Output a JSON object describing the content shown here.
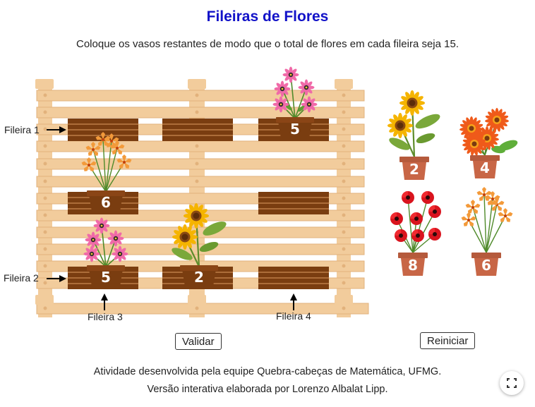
{
  "title": "Fileiras de Flores",
  "instruction": "Coloque os vasos restantes de modo que o total de flores em cada fileira seja 15.",
  "row_labels": {
    "row1": "Fileira 1",
    "row2": "Fileira 2",
    "row3": "Fileira 3",
    "row4": "Fileira 4"
  },
  "board": {
    "r1c1": "",
    "r1c2": "",
    "r1c3": "5",
    "r2c1": "6",
    "r2c2": "",
    "r2c3": "",
    "r3c1": "5",
    "r3c2": "2",
    "r3c3": ""
  },
  "remaining_vases": {
    "v1": "2",
    "v2": "4",
    "v3": "8",
    "v4": "6"
  },
  "buttons": {
    "validate": "Validar",
    "reset": "Reiniciar"
  },
  "footer": {
    "line1": "Atividade desenvolvida pela equipe Quebra-cabeças de Matemática, UFMG.",
    "line2": "Versão interativa elaborada por Lorenzo Albalat Lipp."
  },
  "colors": {
    "title": "#1212c8",
    "wood_light": "#f2cc9c",
    "slot_dark": "#7a3d10",
    "pot": "#b55a3c"
  }
}
